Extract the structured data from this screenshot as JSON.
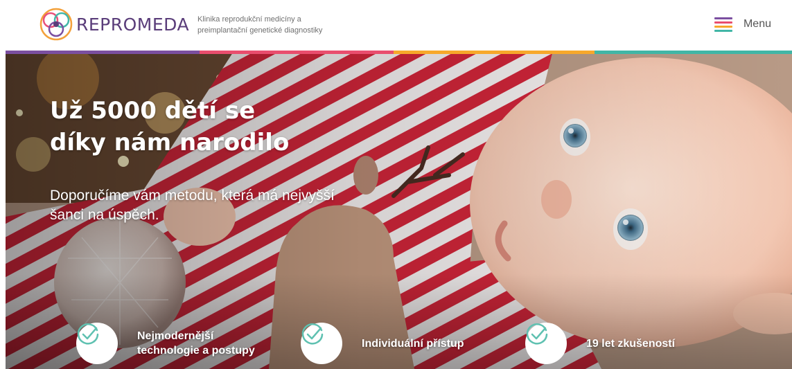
{
  "header": {
    "logo_text": "REPROMEDA",
    "tagline_line1": "Klinika reprodukční medicíny a",
    "tagline_line2": "preimplantační genetické diagnostiky",
    "menu_label": "Menu"
  },
  "hero": {
    "headline_line1": "Už 5000 dětí se",
    "headline_line2": "díky nám narodilo",
    "subheadline_line1": "Doporučíme vám metodu, která má nejvyšší",
    "subheadline_line2": "šanci na úspěch."
  },
  "features": [
    {
      "label_line1": "Nejmodernější",
      "label_line2": "technologie a postupy",
      "icon": "check-icon"
    },
    {
      "label_line1": "Individuální přístup",
      "label_line2": "",
      "icon": "check-icon"
    },
    {
      "label_line1": "19 let zkušeností",
      "label_line2": "",
      "icon": "check-icon"
    }
  ],
  "colors": {
    "brand_purple": "#5a3d7a",
    "check_teal": "#5fc1b1",
    "stripe_red": "#d0263a",
    "menu_bar_colors": [
      "#7b4fa0",
      "#e94e6e",
      "#f7a82b",
      "#41b6a6"
    ]
  }
}
